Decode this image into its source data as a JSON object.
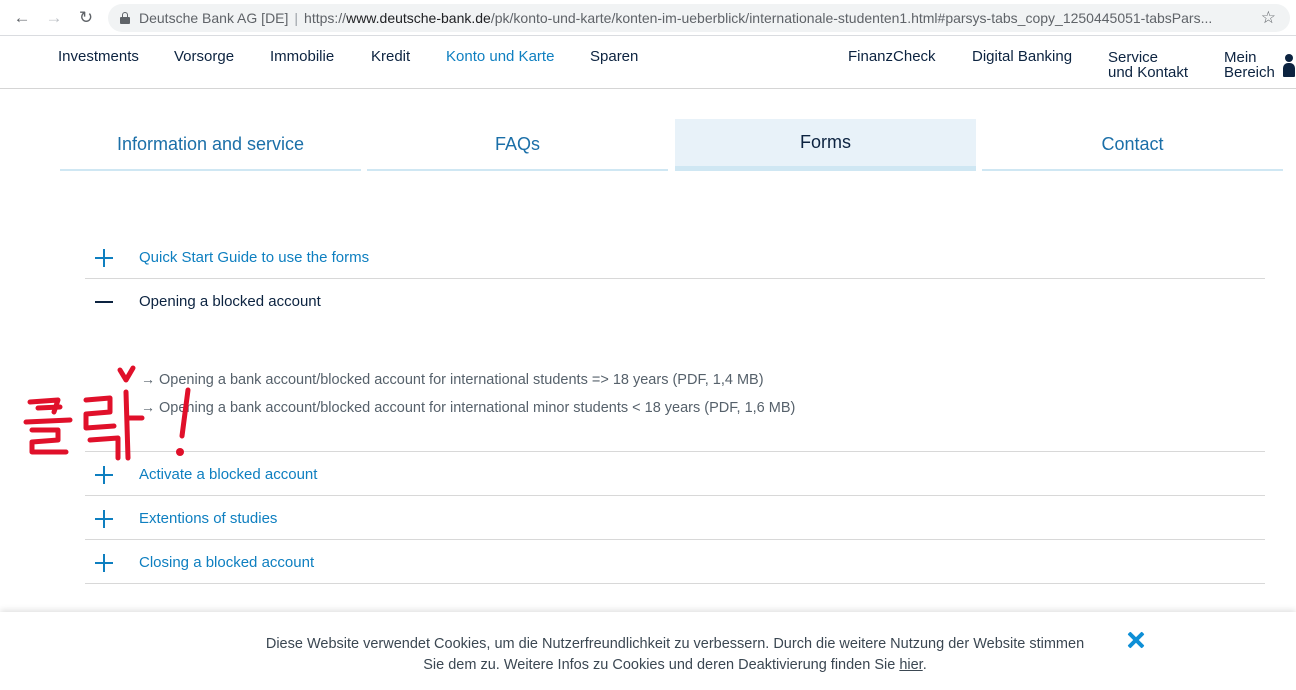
{
  "browser": {
    "back_icon": "←",
    "forward_icon": "→",
    "reload_icon": "↻",
    "site_name": "Deutsche Bank AG [DE]",
    "separator": "|",
    "url_scheme": "https://",
    "url_host": "www.deutsche-bank.de",
    "url_path": "/pk/konto-und-karte/konten-im-ueberblick/internationale-studenten1.html#parsys-tabs_copy_1250445051-tabsPars...",
    "star_icon": "☆"
  },
  "site_nav": {
    "left_items": [
      "Investments",
      "Vorsorge",
      "Immobilie",
      "Kredit",
      "Konto und Karte",
      "Sparen"
    ],
    "active_item": "Konto und Karte",
    "right_items": {
      "finanzcheck": "FinanzCheck",
      "digital_banking": "Digital Banking",
      "service_line1": "Service",
      "service_line2": "und Kontakt",
      "mein_line1": "Mein",
      "mein_line2": "Bereich"
    }
  },
  "tabs": [
    {
      "label": "Information and service",
      "active": false
    },
    {
      "label": "FAQs",
      "active": false
    },
    {
      "label": "Forms",
      "active": true
    },
    {
      "label": "Contact",
      "active": false
    }
  ],
  "accordion": {
    "items": [
      {
        "label": "Quick Start Guide to use the forms",
        "expanded": false
      },
      {
        "label": "Opening a blocked account",
        "expanded": true
      },
      {
        "label": "Activate a blocked account",
        "expanded": false
      },
      {
        "label": "Extentions of studies",
        "expanded": false
      },
      {
        "label": "Closing a blocked account",
        "expanded": false
      }
    ],
    "open_links": [
      "Opening a bank account/blocked account for international students => 18 years (PDF, 1,4 MB)",
      "Opening a bank account/blocked account for international minor students < 18 years (PDF, 1,6 MB)"
    ],
    "link_arrow": "→"
  },
  "annotation": {
    "text": "클릭!",
    "color": "#e0102a"
  },
  "cookie_banner": {
    "line1": "Diese Website verwendet Cookies, um die Nutzerfreundlichkeit zu verbessern. Durch die weitere Nutzung der Website stimmen",
    "line2_prefix": "Sie dem zu. Weitere Infos zu Cookies und deren Deaktivierung finden Sie ",
    "link_text": "hier",
    "line2_suffix": "."
  },
  "colors": {
    "brand_dark": "#0c2340",
    "link_blue": "#0e7fc0",
    "tab_active_bg": "#e8f2f9",
    "close_blue": "#0e8fd6"
  }
}
